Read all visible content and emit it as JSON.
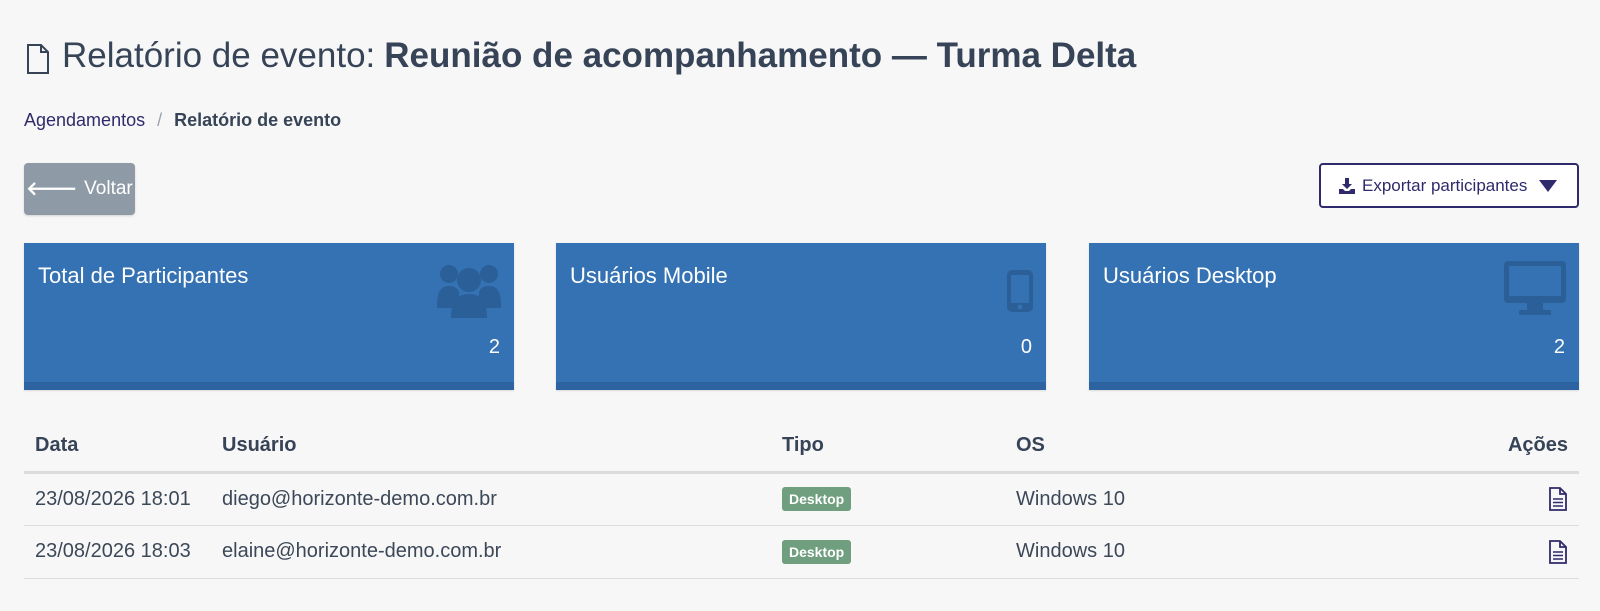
{
  "header": {
    "title_prefix": "Relatório de evento:",
    "event_name": "Reunião de acompanhamento — Turma Delta",
    "icon": "document-icon"
  },
  "breadcrumb": {
    "items": [
      {
        "label": "Agendamentos"
      },
      {
        "label": "Relatório de evento"
      }
    ],
    "separator": "/"
  },
  "toolbar": {
    "back_arrow": "🡐",
    "back_label": "Voltar",
    "export_label": "Exportar participantes"
  },
  "cards": [
    {
      "title": "Total de Participantes",
      "value": "2",
      "icon": "users-group-icon"
    },
    {
      "title": "Usuários Mobile",
      "value": "0",
      "icon": "mobile-phone-icon"
    },
    {
      "title": "Usuários Desktop",
      "value": "2",
      "icon": "desktop-monitor-icon"
    }
  ],
  "table": {
    "columns": [
      "Data",
      "Usuário",
      "Tipo",
      "OS",
      "Ações"
    ],
    "rows": [
      {
        "date": "23/08/2026 18:01",
        "user": "diego@horizonte-demo.com.br",
        "type": "Desktop",
        "os": "Windows 10"
      },
      {
        "date": "23/08/2026 18:03",
        "user": "elaine@horizonte-demo.com.br",
        "type": "Desktop",
        "os": "Windows 10"
      }
    ]
  },
  "colors": {
    "accent": "#2f2a6b",
    "card_bg": "#3472b4",
    "badge_desktop": "#6f9f7e",
    "back_button": "#8e9ba7"
  }
}
